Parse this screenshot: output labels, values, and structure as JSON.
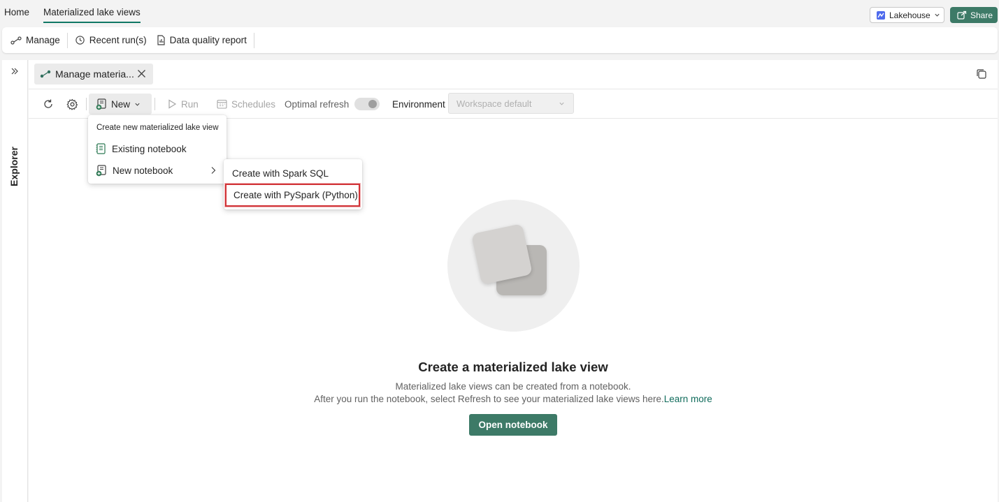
{
  "top_tabs": {
    "home": "Home",
    "materialized": "Materialized lake views"
  },
  "header_right": {
    "lakehouse": "Lakehouse",
    "share": "Share"
  },
  "ribbon": {
    "manage": "Manage",
    "recent_runs": "Recent run(s)",
    "dq_report": "Data quality report"
  },
  "explorer": {
    "label": "Explorer"
  },
  "doc_tab": {
    "label": "Manage materia..."
  },
  "toolbar": {
    "new": "New",
    "run": "Run",
    "schedules": "Schedules",
    "optimal_refresh": "Optimal refresh",
    "environment": "Environment",
    "environment_value": "Workspace default"
  },
  "new_menu": {
    "header": "Create new materialized lake view",
    "items": [
      "Existing notebook",
      "New notebook"
    ]
  },
  "submenu": {
    "items": [
      "Create with Spark SQL",
      "Create with PySpark (Python)"
    ]
  },
  "empty_state": {
    "title": "Create a materialized lake view",
    "line1": "Materialized lake views can be created from a notebook.",
    "line2": "After you run the notebook, select Refresh to see your materialized lake views here.",
    "learn_more": "Learn more",
    "button": "Open notebook"
  },
  "colors": {
    "accent": "#117865",
    "button": "#3d7a67",
    "highlight": "#d13438"
  }
}
